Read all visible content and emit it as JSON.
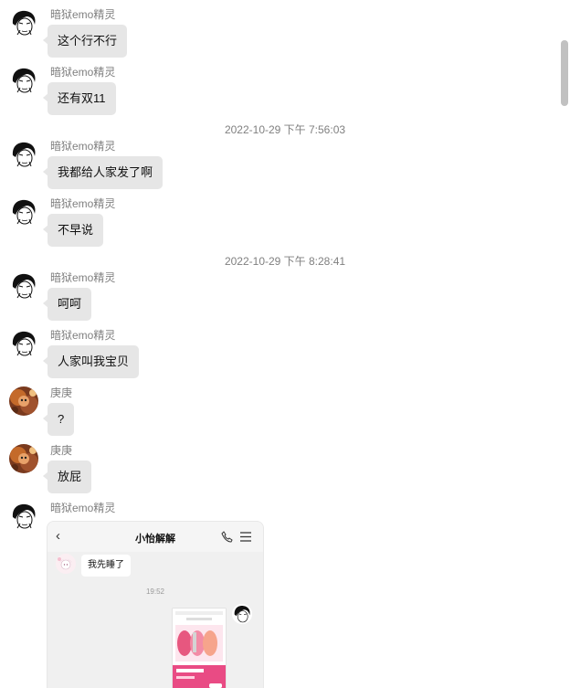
{
  "messages": [
    {
      "sender": "暗狱emo精灵",
      "text": "这个行不行",
      "avatar": "emo-avatar"
    },
    {
      "sender": "暗狱emo精灵",
      "text": "还有双11",
      "avatar": "emo-avatar"
    },
    {
      "timestamp": "2022-10-29 下午 7:56:03"
    },
    {
      "sender": "暗狱emo精灵",
      "text": "我都给人家发了啊",
      "avatar": "emo-avatar"
    },
    {
      "sender": "暗狱emo精灵",
      "text": "不早说",
      "avatar": "emo-avatar"
    },
    {
      "timestamp": "2022-10-29 下午 8:28:41"
    },
    {
      "sender": "暗狱emo精灵",
      "text": "呵呵",
      "avatar": "emo-avatar"
    },
    {
      "sender": "暗狱emo精灵",
      "text": "人家叫我宝贝",
      "avatar": "emo-avatar"
    },
    {
      "sender": "庚庚",
      "text": "?",
      "avatar": "cat-avatar"
    },
    {
      "sender": "庚庚",
      "text": "放屁",
      "avatar": "cat-avatar"
    },
    {
      "sender": "暗狱emo精灵",
      "avatar": "emo-avatar",
      "image": true
    }
  ],
  "screenshot": {
    "back_icon": "chevron-left-icon",
    "title": "小怡解解",
    "phone_icon": "phone-icon",
    "menu_icon": "menu-icon",
    "bubble_text": "我先睡了",
    "time": "19:52"
  },
  "colors": {
    "bubble": "#e6e6e6",
    "meta_text": "#808080",
    "background": "#ffffff"
  }
}
